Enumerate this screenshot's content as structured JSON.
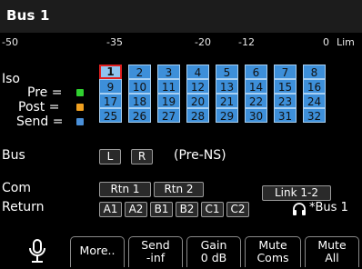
{
  "header": {
    "title": "Bus 1"
  },
  "meter_scale": [
    "-50",
    "-35",
    "-20",
    "-12",
    "0",
    "Lim"
  ],
  "labels": {
    "iso": "Iso",
    "pre": "Pre =",
    "post": "Post =",
    "send": "Send =",
    "bus": "Bus",
    "com": "Com",
    "return": "Return"
  },
  "legend_colors": {
    "pre": "#30d030",
    "post": "#f0a020",
    "send": "#4a90d9"
  },
  "channels": [
    "1",
    "2",
    "3",
    "4",
    "5",
    "6",
    "7",
    "8",
    "9",
    "10",
    "11",
    "12",
    "13",
    "14",
    "15",
    "16",
    "17",
    "18",
    "19",
    "20",
    "21",
    "22",
    "23",
    "24",
    "25",
    "26",
    "27",
    "28",
    "29",
    "30",
    "31",
    "32"
  ],
  "bus": {
    "left": "L",
    "right": "R",
    "mode": "(Pre-NS)"
  },
  "com": {
    "rtn1": "Rtn 1",
    "rtn2": "Rtn 2",
    "link": "Link 1-2"
  },
  "return": {
    "sources": [
      "A1",
      "A2",
      "B1",
      "B2",
      "C1",
      "C2"
    ],
    "headphone_target": "*Bus 1"
  },
  "softkeys": {
    "more": "More..",
    "send_line1": "Send",
    "send_line2": "-inf",
    "gain_line1": "Gain",
    "gain_line2": "0 dB",
    "mute_coms_line1": "Mute",
    "mute_coms_line2": "Coms",
    "mute_all_line1": "Mute",
    "mute_all_line2": "All"
  },
  "icons": {
    "mic": "microphone-icon",
    "headphones": "headphones-icon"
  }
}
